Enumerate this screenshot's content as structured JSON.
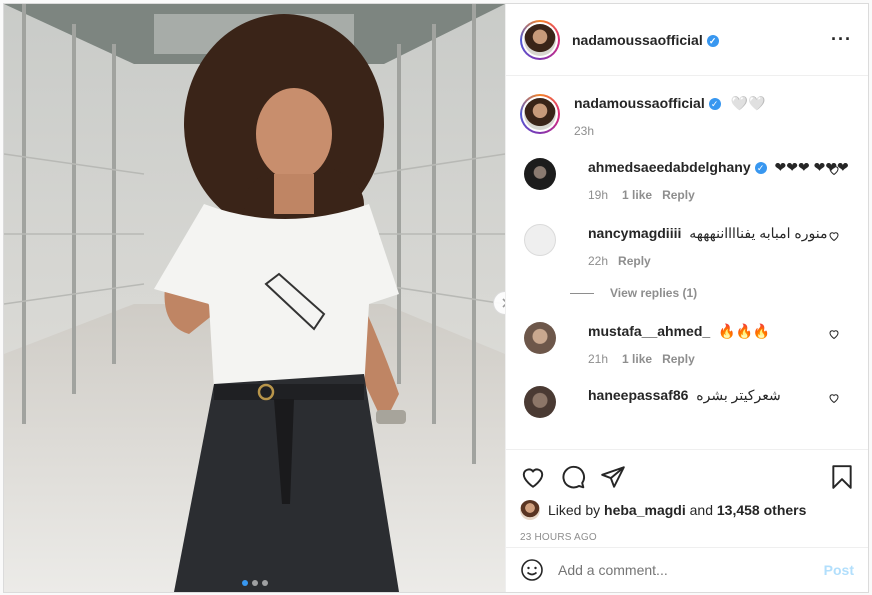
{
  "post": {
    "author": "nadamoussaofficial",
    "caption": "🤍🤍",
    "caption_time": "23h",
    "more_icon": "more-horizontal-icon"
  },
  "comments": [
    {
      "user": "ahmedsaeedabdelghany",
      "verified": true,
      "text": "❤❤❤ ❤❤❤",
      "time": "19h",
      "likes": "1 like",
      "reply": "Reply",
      "avatar_color": "#2b2b2b"
    },
    {
      "user": "nancymagdiiii",
      "verified": false,
      "text": "منوره امبابه يفنااااننهههه",
      "time": "22h",
      "likes": "",
      "reply": "Reply",
      "avatar_color": "#dbdbdb"
    },
    {
      "user": "mustafa__ahmed_",
      "verified": false,
      "text": "🔥🔥🔥",
      "time": "21h",
      "likes": "1 like",
      "reply": "Reply",
      "avatar_color": "#8a6f5e"
    },
    {
      "user": "haneepassaf86",
      "verified": false,
      "text": "شعركيتر بشره",
      "time": "",
      "likes": "",
      "reply": "",
      "avatar_color": "#6b5a52"
    }
  ],
  "view_replies": "View replies (1)",
  "likes": {
    "prefix": "Liked by",
    "user": "heba_magdi",
    "mid": "and",
    "count": "13,458 others"
  },
  "timestamp": "23 HOURS AGO",
  "add_comment": {
    "placeholder": "Add a comment...",
    "post_label": "Post"
  },
  "colors": {
    "accent": "#3897f0",
    "post_disabled": "#b2dffc"
  }
}
